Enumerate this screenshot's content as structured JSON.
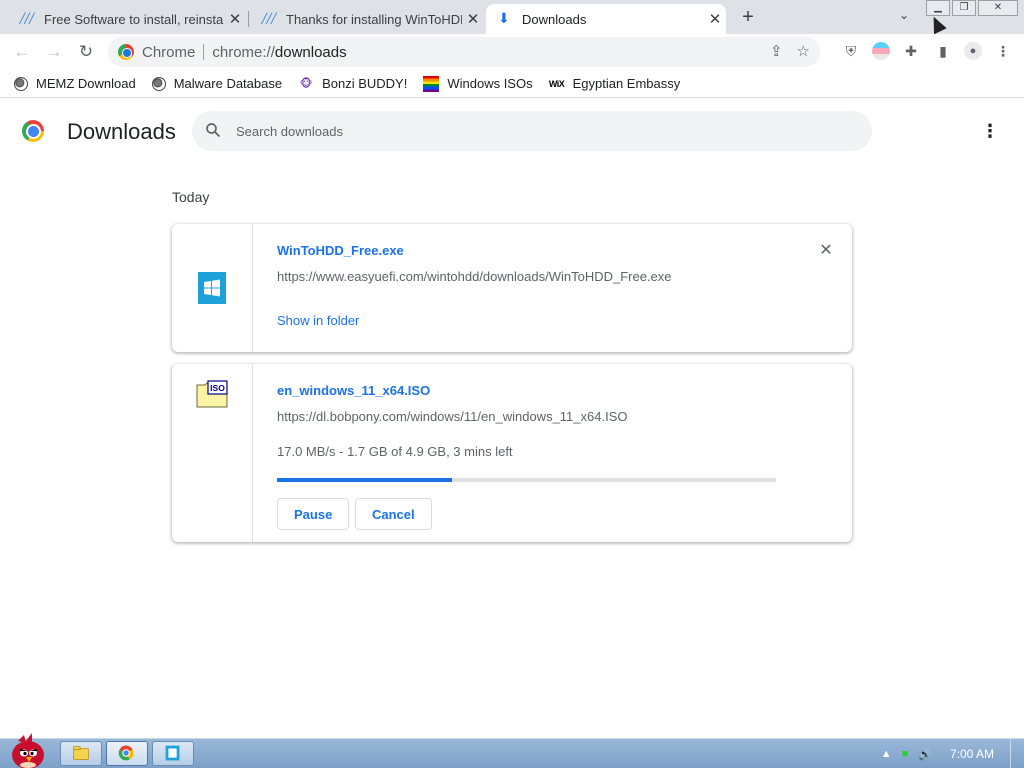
{
  "browser": {
    "tabs": [
      {
        "title": "Free Software to install, reinsta",
        "active": false
      },
      {
        "title": "Thanks for installing WinToHDD",
        "active": false
      },
      {
        "title": "Downloads",
        "active": true
      }
    ],
    "omnibox": {
      "label": "Chrome",
      "url_prefix": "chrome://",
      "url_host": "downloads"
    },
    "bookmarks": [
      {
        "label": "MEMZ Download",
        "icon": "globe-icon"
      },
      {
        "label": "Malware Database",
        "icon": "globe-icon"
      },
      {
        "label": "Bonzi BUDDY!",
        "icon": "bonzi-icon"
      },
      {
        "label": "Windows ISOs",
        "icon": "rainbow-flag-icon"
      },
      {
        "label": "Egyptian Embassy",
        "icon": "wix-icon"
      }
    ],
    "win_icon_text": "WiX"
  },
  "page": {
    "title": "Downloads",
    "search_placeholder": "Search downloads",
    "section_label": "Today"
  },
  "downloads": [
    {
      "file_name": "WinToHDD_Free.exe",
      "url": "https://www.easyuefi.com/wintohdd/downloads/WinToHDD_Free.exe",
      "action_label": "Show in folder",
      "icon": "windows-app-icon"
    },
    {
      "file_name": "en_windows_11_x64.ISO",
      "url": "https://dl.bobpony.com/windows/11/en_windows_11_x64.ISO",
      "status": "17.0 MB/s - 1.7 GB of 4.9 GB, 3 mins left",
      "progress": 0.35,
      "pause_label": "Pause",
      "cancel_label": "Cancel",
      "icon": "iso-file-icon",
      "iso_badge": "ISO"
    }
  ],
  "taskbar": {
    "clock": "7:00 AM"
  },
  "colors": {
    "accent": "#1a73e8",
    "tabstrip": "#dee1e6",
    "taskbar": "#8aaed2"
  }
}
